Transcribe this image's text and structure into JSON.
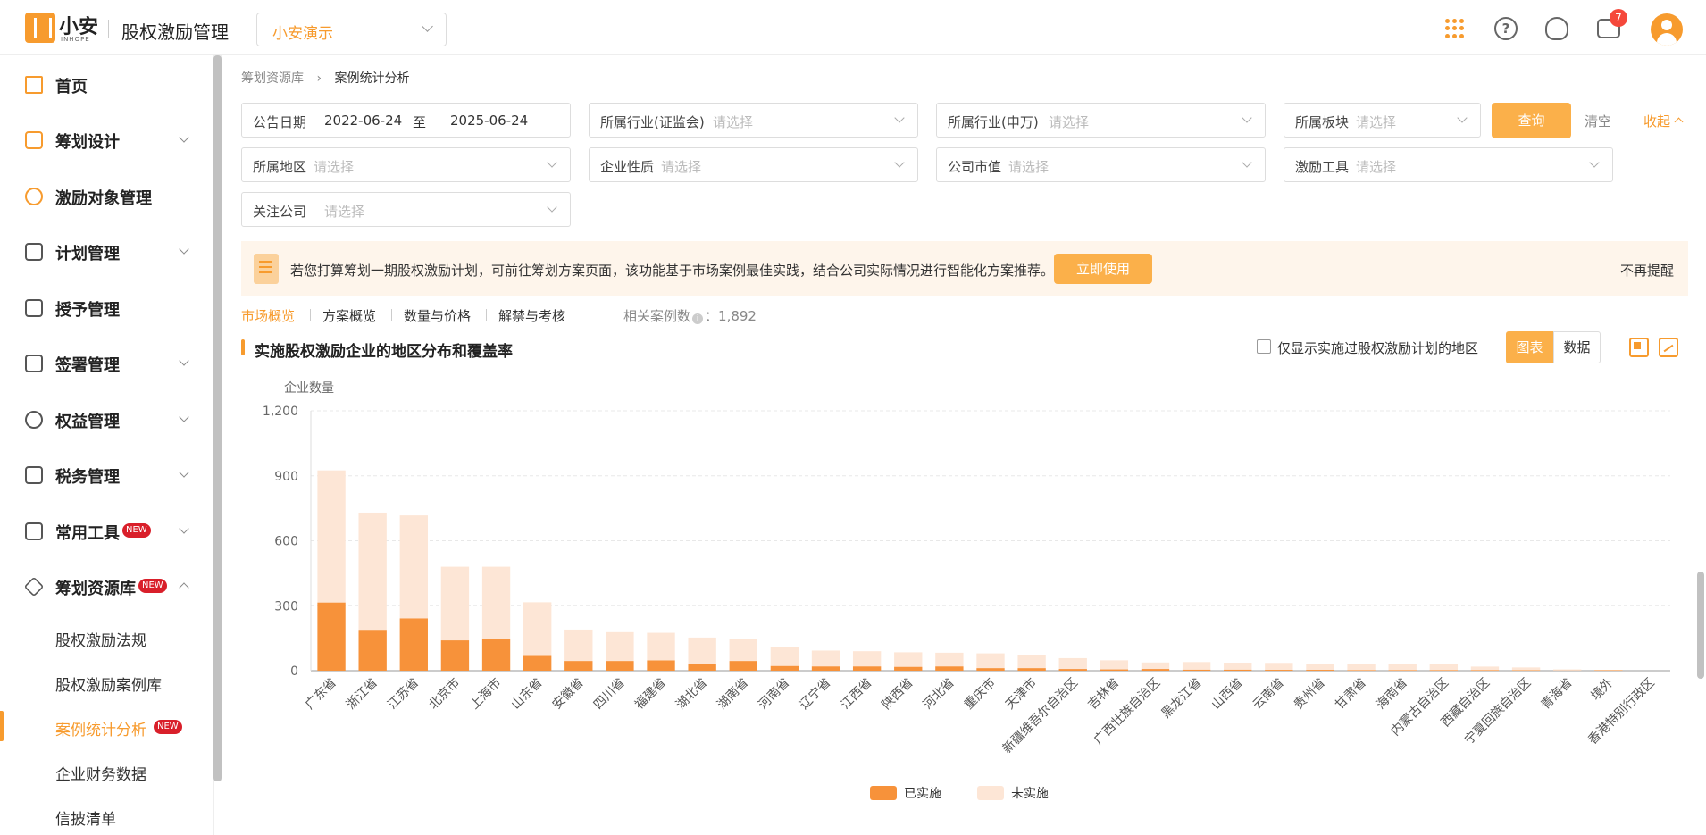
{
  "header": {
    "logo_name": "小安",
    "logo_sub": "INHOPE",
    "app_title": "股权激励管理",
    "company_select": "小安演示",
    "message_count": "7",
    "icons": [
      "apps-grid-icon",
      "help-icon",
      "customer-service-icon",
      "message-icon",
      "user-avatar"
    ]
  },
  "sidebar": {
    "items": [
      {
        "label": "首页",
        "icon": "home-icon",
        "expandable": false
      },
      {
        "label": "筹划设计",
        "icon": "edit-icon",
        "expandable": true
      },
      {
        "label": "激励对象管理",
        "icon": "users-icon",
        "expandable": false
      },
      {
        "label": "计划管理",
        "icon": "plan-icon",
        "expandable": true
      },
      {
        "label": "授予管理",
        "icon": "grant-icon",
        "expandable": false
      },
      {
        "label": "签署管理",
        "icon": "sign-icon",
        "expandable": true
      },
      {
        "label": "权益管理",
        "icon": "equity-icon",
        "expandable": true
      },
      {
        "label": "税务管理",
        "icon": "tax-icon",
        "expandable": true
      },
      {
        "label": "常用工具",
        "icon": "toolbox-icon",
        "expandable": true,
        "badge": "NEW"
      },
      {
        "label": "筹划资源库",
        "icon": "layers-icon",
        "expandable": true,
        "expanded": true,
        "badge": "NEW"
      }
    ],
    "sub_items": [
      {
        "label": "股权激励法规"
      },
      {
        "label": "股权激励案例库"
      },
      {
        "label": "案例统计分析",
        "active": true,
        "badge": "NEW"
      },
      {
        "label": "企业财务数据"
      },
      {
        "label": "信披清单"
      }
    ]
  },
  "breadcrumb": {
    "parent": "筹划资源库",
    "current": "案例统计分析"
  },
  "filters": {
    "date_label": "公告日期",
    "date_from": "2022-06-24",
    "date_to_sep": "至",
    "date_to": "2025-06-24",
    "industry_csrc": {
      "label": "所属行业(证监会)",
      "placeholder": "请选择"
    },
    "industry_sw": {
      "label": "所属行业(申万)",
      "placeholder": "请选择"
    },
    "board": {
      "label": "所属板块",
      "placeholder": "请选择"
    },
    "region": {
      "label": "所属地区",
      "placeholder": "请选择"
    },
    "nature": {
      "label": "企业性质",
      "placeholder": "请选择"
    },
    "market_value": {
      "label": "公司市值",
      "placeholder": "请选择"
    },
    "tool": {
      "label": "激励工具",
      "placeholder": "请选择"
    },
    "followed": {
      "label": "关注公司",
      "placeholder": "请选择"
    },
    "query_btn": "查询",
    "clear_btn": "清空",
    "collapse_btn": "收起"
  },
  "tip": {
    "text": "若您打算筹划一期股权激励计划，可前往筹划方案页面，该功能基于市场案例最佳实践，结合公司实际情况进行智能化方案推荐。",
    "button": "立即使用",
    "dismiss": "不再提醒"
  },
  "tabs": [
    {
      "label": "市场概览",
      "active": true
    },
    {
      "label": "方案概览"
    },
    {
      "label": "数量与价格"
    },
    {
      "label": "解禁与考核"
    }
  ],
  "case_count": {
    "label": "相关案例数",
    "value": "1,892"
  },
  "section": {
    "title": "实施股权激励企业的地区分布和覆盖率",
    "checkbox_label": "仅显示实施过股权激励计划的地区",
    "toggle_chart": "图表",
    "toggle_data": "数据"
  },
  "colors": {
    "accent": "#f79b2e",
    "implemented": "#f7923a",
    "not_implemented": "#fde6d6"
  },
  "chart_data": {
    "type": "bar",
    "stacked": true,
    "ylabel": "企业数量",
    "ylim": [
      0,
      1200
    ],
    "yticks": [
      "0",
      "300",
      "600",
      "900",
      "1,200"
    ],
    "grid": true,
    "legend_position": "bottom-center",
    "categories": [
      "广东省",
      "浙江省",
      "江苏省",
      "北京市",
      "上海市",
      "山东省",
      "安徽省",
      "四川省",
      "福建省",
      "湖北省",
      "湖南省",
      "河南省",
      "辽宁省",
      "江西省",
      "陕西省",
      "河北省",
      "重庆市",
      "天津市",
      "新疆维吾尔自治区",
      "吉林省",
      "广西壮族自治区",
      "黑龙江省",
      "山西省",
      "云南省",
      "贵州省",
      "甘肃省",
      "海南省",
      "内蒙古自治区",
      "西藏自治区",
      "宁夏回族自治区",
      "青海省",
      "境外",
      "香港特别行政区"
    ],
    "series": [
      {
        "name": "已实施",
        "values": [
          315,
          185,
          242,
          140,
          145,
          68,
          45,
          45,
          48,
          33,
          45,
          22,
          20,
          20,
          18,
          20,
          12,
          12,
          8,
          6,
          8,
          5,
          5,
          4,
          4,
          3,
          3,
          3,
          3,
          2,
          1,
          2,
          0
        ]
      },
      {
        "name": "未实施",
        "values": [
          610,
          545,
          475,
          340,
          335,
          248,
          145,
          133,
          127,
          120,
          100,
          88,
          73,
          70,
          67,
          63,
          68,
          60,
          50,
          42,
          30,
          35,
          32,
          32,
          28,
          30,
          28,
          27,
          16,
          13,
          5,
          2,
          0
        ]
      }
    ]
  }
}
